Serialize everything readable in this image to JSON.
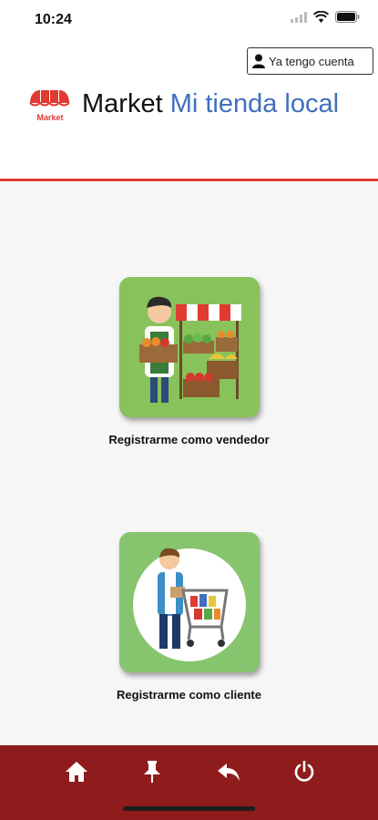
{
  "status_bar": {
    "time": "10:24"
  },
  "header": {
    "account_button_label": "Ya tengo cuenta",
    "logo_text": "Market",
    "brand_name": "Market",
    "brand_tagline": "Mi tienda local"
  },
  "options": [
    {
      "label": "Registrarme como vendedor",
      "icon": "vendor-illustration"
    },
    {
      "label": "Registrarme como cliente",
      "icon": "shopper-illustration"
    }
  ],
  "bottom_nav": {
    "items": [
      {
        "icon": "home-icon"
      },
      {
        "icon": "pin-icon"
      },
      {
        "icon": "back-arrow-icon"
      },
      {
        "icon": "power-icon"
      }
    ]
  },
  "colors": {
    "accent_red": "#e03a31",
    "nav_background": "#8f1c1c",
    "tagline_blue": "#3f6fc1"
  }
}
